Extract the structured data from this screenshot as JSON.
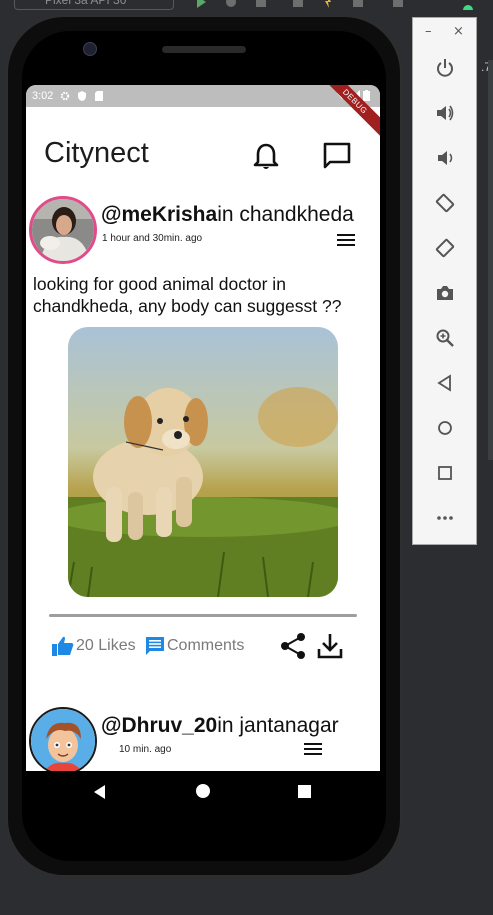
{
  "ide": {
    "device_name": "Pixel 3a API 30",
    "edge_text": ".7"
  },
  "status_bar": {
    "time": "3:02",
    "debug_label": "DEBUG"
  },
  "app": {
    "title": "Citynect",
    "brand_color": "#e04b8a"
  },
  "posts": [
    {
      "handle": "@meKrisha",
      "location": "in chandkheda",
      "time_ago": "1 hour and 30min. ago",
      "text": "looking for good animal doctor in chandkheda, any body can suggesst ??",
      "likes_label": "20 Likes",
      "comments_label": "Comments"
    },
    {
      "handle": "@Dhruv_20",
      "location": "in jantanagar",
      "time_ago": "10 min. ago"
    }
  ],
  "icons": {
    "notifications": "bell-icon",
    "messages": "chat-icon",
    "like": "thumbs-up-icon",
    "comment": "comment-icon",
    "share": "share-icon",
    "download": "download-icon",
    "menu": "hamburger-menu-icon"
  },
  "colors": {
    "like_blue": "#1e88e5",
    "status_bar": "#bdbdbd"
  },
  "emulator_panel": {
    "buttons": [
      "power-icon",
      "volume-up-icon",
      "volume-down-icon",
      "rotate-left-icon",
      "rotate-right-icon",
      "camera-icon",
      "zoom-icon",
      "back-icon",
      "home-icon",
      "overview-icon",
      "more-icon"
    ]
  }
}
